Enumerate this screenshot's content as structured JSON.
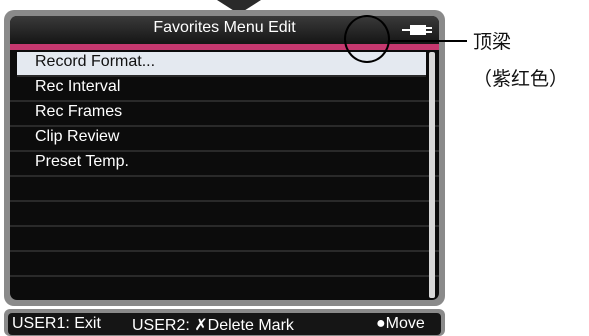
{
  "screen": {
    "title": "Favorites Menu Edit",
    "items": [
      {
        "label": "Record Format...",
        "selected": true
      },
      {
        "label": "Rec Interval"
      },
      {
        "label": "Rec Frames"
      },
      {
        "label": "Clip Review"
      },
      {
        "label": "Preset Temp."
      }
    ]
  },
  "status_bar": {
    "user1": "USER1: Exit",
    "user2": "USER2: ✗Delete Mark",
    "move": "●Move"
  },
  "annotation": {
    "line1": "顶梁",
    "line2": "（紫红色）"
  },
  "colors": {
    "accent": "#c6386f",
    "selected_row": "#e4e9f0",
    "background": "#0c0c0c"
  },
  "icons": {
    "power": "battery-plug-icon",
    "top": "down-arrow-icon"
  }
}
